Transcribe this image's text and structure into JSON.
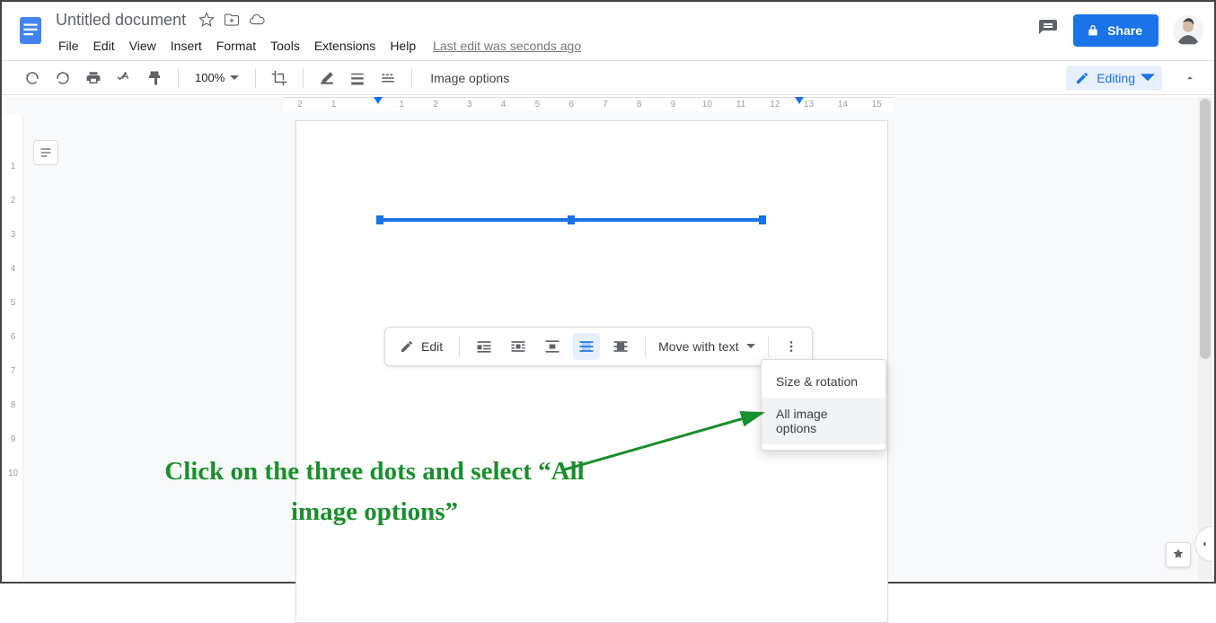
{
  "header": {
    "doc_title": "Untitled document",
    "last_edit": "Last edit was seconds ago",
    "share_label": "Share",
    "menu": [
      "File",
      "Edit",
      "View",
      "Insert",
      "Format",
      "Tools",
      "Extensions",
      "Help"
    ]
  },
  "toolbar": {
    "zoom": "100%",
    "mode_label": "Editing",
    "context_label": "Image options"
  },
  "image_toolbar": {
    "edit_label": "Edit",
    "move_label": "Move with text"
  },
  "dropdown": {
    "items": [
      "Size & rotation",
      "All image options"
    ]
  },
  "annotation": {
    "text": "Click on the three dots and select “All image options”"
  },
  "ruler": {
    "h_ticks": [
      "2",
      "1",
      "",
      "1",
      "2",
      "3",
      "4",
      "5",
      "6",
      "7",
      "8",
      "9",
      "10",
      "11",
      "12",
      "13",
      "14",
      "15"
    ],
    "v_ticks": [
      "",
      "1",
      "2",
      "3",
      "4",
      "5",
      "6",
      "7",
      "8",
      "9",
      "10"
    ]
  }
}
